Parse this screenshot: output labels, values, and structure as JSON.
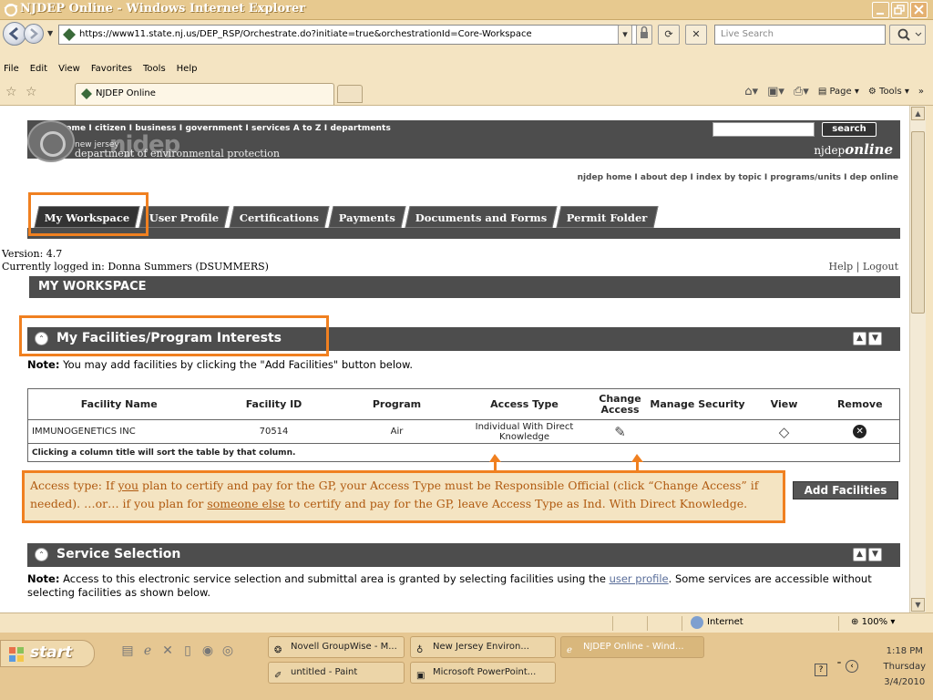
{
  "window": {
    "title": "NJDEP Online - Windows Internet Explorer",
    "url": "https://www11.state.nj.us/DEP_RSP/Orchestrate.do?initiate=true&orchestrationId=Core-Workspace",
    "live_search_placeholder": "Live Search",
    "menu": [
      "File",
      "Edit",
      "View",
      "Favorites",
      "Tools",
      "Help"
    ],
    "tab_title": "NJDEP Online",
    "cmd_page": "Page",
    "cmd_tools": "Tools"
  },
  "header": {
    "top_links": "njhome  I  citizen  I  business  I  government  I  services A to Z  I  departments",
    "search_button": "search",
    "brand_state": "new jersey",
    "brand_name": "njdep",
    "brand_sub": "department of environmental protection",
    "online_prefix": "njdep",
    "online_suffix": "online",
    "sublinks": "njdep home  I  about dep  I  index by topic  I  programs/units  I  dep online"
  },
  "tabs": [
    {
      "label": "My Workspace",
      "active": true
    },
    {
      "label": "User Profile",
      "active": false
    },
    {
      "label": "Certifications",
      "active": false
    },
    {
      "label": "Payments",
      "active": false
    },
    {
      "label": "Documents and Forms",
      "active": false
    },
    {
      "label": "Permit Folder",
      "active": false
    }
  ],
  "session": {
    "version": "Version: 4.7",
    "logged_in": "Currently logged in: Donna Summers (DSUMMERS)",
    "help_logout": "Help | Logout"
  },
  "workspace_title": "MY WORKSPACE",
  "facilities": {
    "title": "My Facilities/Program Interests",
    "note_label": "Note:",
    "note_text": " You may add facilities by clicking the \"Add Facilities\" button below.",
    "columns": [
      "Facility Name",
      "Facility ID",
      "Program",
      "Access Type",
      "Change Access",
      "Manage Security",
      "View",
      "Remove"
    ],
    "rows": [
      {
        "name": "IMMUNOGENETICS INC",
        "id": "70514",
        "program": "Air",
        "access_type": "Individual With Direct Knowledge"
      }
    ],
    "sort_note": "Clicking a column title will sort the table by that column.",
    "add_button": "Add Facilities"
  },
  "callout": {
    "p1": "Access type:  If ",
    "u1": "you",
    "p2": " plan to certify and pay for the GP, your Access Type must be Responsible Official (click “Change Access” if needed).  …or… if you plan for ",
    "u2": "someone else",
    "p3": " to certify and pay for the GP,  leave Access Type as Ind. With Direct Knowledge."
  },
  "service": {
    "title": "Service Selection",
    "note_label": "Note:",
    "note_text_1": " Access to this electronic service selection and submittal area is granted by selecting facilities using the ",
    "note_link": "user profile",
    "note_text_2": ". Some services are accessible without selecting facilities as shown below."
  },
  "statusbar": {
    "zone": "Internet",
    "zoom": "100%"
  },
  "taskbar": {
    "start": "start",
    "tasks_row1": [
      "Novell GroupWise - M...",
      "New Jersey Environ...",
      "NJDEP Online - Wind..."
    ],
    "tasks_row2": [
      "untitled - Paint",
      "Microsoft PowerPoint..."
    ],
    "time": "1:18 PM",
    "day": "Thursday",
    "date": "3/4/2010"
  },
  "colors": {
    "highlight": "#f08020",
    "header_gray": "#4d4d4d",
    "chrome": "#f4e4c2"
  }
}
